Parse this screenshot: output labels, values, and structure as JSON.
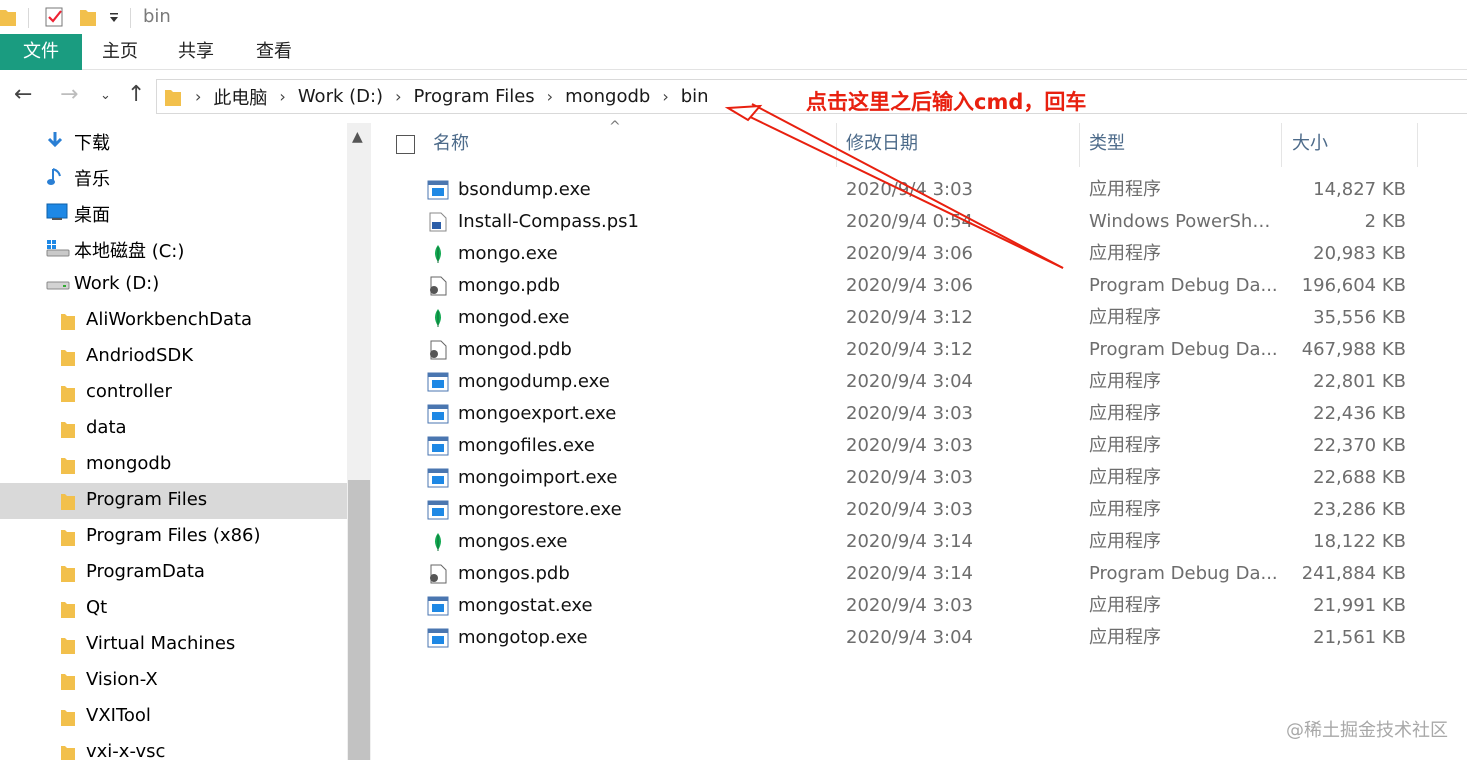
{
  "window": {
    "title": "bin"
  },
  "ribbon": {
    "tabs": [
      "文件",
      "主页",
      "共享",
      "查看"
    ]
  },
  "address": {
    "crumbs": [
      "此电脑",
      "Work (D:)",
      "Program Files",
      "mongodb",
      "bin"
    ],
    "separator": "›"
  },
  "annotation": {
    "text": "点击这里之后输入cmd，回车",
    "color": "#e8200f"
  },
  "sidebar": {
    "items": [
      {
        "label": "下载",
        "icon": "download-icon"
      },
      {
        "label": "音乐",
        "icon": "music-icon"
      },
      {
        "label": "桌面",
        "icon": "desktop-icon"
      },
      {
        "label": "本地磁盘 (C:)",
        "icon": "system-drive-icon"
      },
      {
        "label": "Work (D:)",
        "icon": "drive-icon"
      },
      {
        "label": "AliWorkbenchData",
        "icon": "folder-icon"
      },
      {
        "label": "AndriodSDK",
        "icon": "folder-icon"
      },
      {
        "label": "controller",
        "icon": "folder-icon"
      },
      {
        "label": "data",
        "icon": "folder-icon"
      },
      {
        "label": "mongodb",
        "icon": "folder-icon"
      },
      {
        "label": "Program Files",
        "icon": "folder-icon",
        "selected": true
      },
      {
        "label": "Program Files (x86)",
        "icon": "folder-icon"
      },
      {
        "label": "ProgramData",
        "icon": "folder-icon"
      },
      {
        "label": "Qt",
        "icon": "folder-icon"
      },
      {
        "label": "Virtual Machines",
        "icon": "folder-icon"
      },
      {
        "label": "Vision-X",
        "icon": "folder-icon"
      },
      {
        "label": "VXITool",
        "icon": "folder-icon"
      },
      {
        "label": "vxi-x-vsc",
        "icon": "folder-icon"
      }
    ]
  },
  "columns": {
    "name": "名称",
    "date": "修改日期",
    "type": "类型",
    "size": "大小"
  },
  "files": [
    {
      "name": "bsondump.exe",
      "date": "2020/9/4 3:03",
      "type": "应用程序",
      "size": "14,827 KB",
      "icon": "exe"
    },
    {
      "name": "Install-Compass.ps1",
      "date": "2020/9/4 0:54",
      "type": "Windows PowerShe...",
      "size": "2 KB",
      "icon": "ps1"
    },
    {
      "name": "mongo.exe",
      "date": "2020/9/4 3:06",
      "type": "应用程序",
      "size": "20,983 KB",
      "icon": "leaf"
    },
    {
      "name": "mongo.pdb",
      "date": "2020/9/4 3:06",
      "type": "Program Debug Da...",
      "size": "196,604 KB",
      "icon": "pdb"
    },
    {
      "name": "mongod.exe",
      "date": "2020/9/4 3:12",
      "type": "应用程序",
      "size": "35,556 KB",
      "icon": "leaf"
    },
    {
      "name": "mongod.pdb",
      "date": "2020/9/4 3:12",
      "type": "Program Debug Da...",
      "size": "467,988 KB",
      "icon": "pdb"
    },
    {
      "name": "mongodump.exe",
      "date": "2020/9/4 3:04",
      "type": "应用程序",
      "size": "22,801 KB",
      "icon": "exe"
    },
    {
      "name": "mongoexport.exe",
      "date": "2020/9/4 3:03",
      "type": "应用程序",
      "size": "22,436 KB",
      "icon": "exe"
    },
    {
      "name": "mongofiles.exe",
      "date": "2020/9/4 3:03",
      "type": "应用程序",
      "size": "22,370 KB",
      "icon": "exe"
    },
    {
      "name": "mongoimport.exe",
      "date": "2020/9/4 3:03",
      "type": "应用程序",
      "size": "22,688 KB",
      "icon": "exe"
    },
    {
      "name": "mongorestore.exe",
      "date": "2020/9/4 3:03",
      "type": "应用程序",
      "size": "23,286 KB",
      "icon": "exe"
    },
    {
      "name": "mongos.exe",
      "date": "2020/9/4 3:14",
      "type": "应用程序",
      "size": "18,122 KB",
      "icon": "leaf"
    },
    {
      "name": "mongos.pdb",
      "date": "2020/9/4 3:14",
      "type": "Program Debug Da...",
      "size": "241,884 KB",
      "icon": "pdb"
    },
    {
      "name": "mongostat.exe",
      "date": "2020/9/4 3:03",
      "type": "应用程序",
      "size": "21,991 KB",
      "icon": "exe"
    },
    {
      "name": "mongotop.exe",
      "date": "2020/9/4 3:04",
      "type": "应用程序",
      "size": "21,561 KB",
      "icon": "exe"
    }
  ],
  "watermark": {
    "text": "@稀土掘金技术社区"
  },
  "colors": {
    "file_tab": "#1a9c80",
    "folder": "#f2c04c",
    "selected_row": "#d9d9d9"
  }
}
